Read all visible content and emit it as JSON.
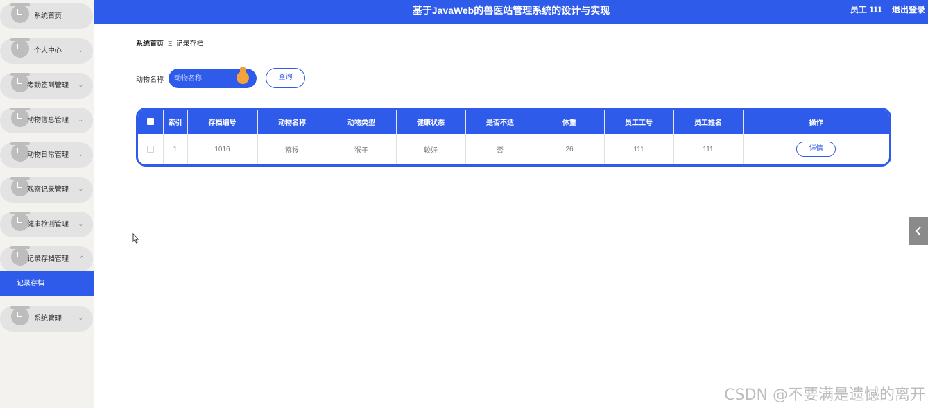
{
  "header": {
    "title": "基于JavaWeb的兽医站管理系统的设计与实现",
    "user": "员工 111",
    "logout": "退出登录"
  },
  "sidebar": {
    "items": [
      {
        "label": "系统首页",
        "expanded": false,
        "chevron": ""
      },
      {
        "label": "个人中心",
        "expanded": false,
        "chevron": "⌄"
      },
      {
        "label": "考勤签到管理",
        "expanded": false,
        "chevron": "⌄"
      },
      {
        "label": "动物信息管理",
        "expanded": false,
        "chevron": "⌄"
      },
      {
        "label": "动物日常管理",
        "expanded": false,
        "chevron": "⌄"
      },
      {
        "label": "观察记录管理",
        "expanded": false,
        "chevron": "⌄"
      },
      {
        "label": "健康检测管理",
        "expanded": false,
        "chevron": "⌄"
      },
      {
        "label": "记录存档管理",
        "expanded": true,
        "chevron": "^"
      },
      {
        "label": "系统管理",
        "expanded": false,
        "chevron": "⌄"
      }
    ],
    "active_sub": "记录存档"
  },
  "breadcrumb": {
    "home": "系统首页",
    "sep": "Ξ",
    "current": "记录存档"
  },
  "search": {
    "label": "动物名称",
    "placeholder": "动物名称",
    "button": "查询"
  },
  "table": {
    "headers": [
      "索引",
      "存档编号",
      "动物名称",
      "动物类型",
      "健康状态",
      "是否不适",
      "体重",
      "员工工号",
      "员工姓名",
      "操作"
    ],
    "rows": [
      {
        "index": "1",
        "archive_no": "1016",
        "animal_name": "猕猴",
        "animal_type": "猴子",
        "health": "较好",
        "unwell": "否",
        "weight": "26",
        "emp_no": "111",
        "emp_name": "111",
        "action": "详情"
      }
    ]
  },
  "watermark": "CSDN @不要满是遗憾的离开",
  "colors": {
    "primary": "#2f5bea",
    "accent_pin": "#f3a33a",
    "sidebar_bg": "#f3f2ee"
  }
}
